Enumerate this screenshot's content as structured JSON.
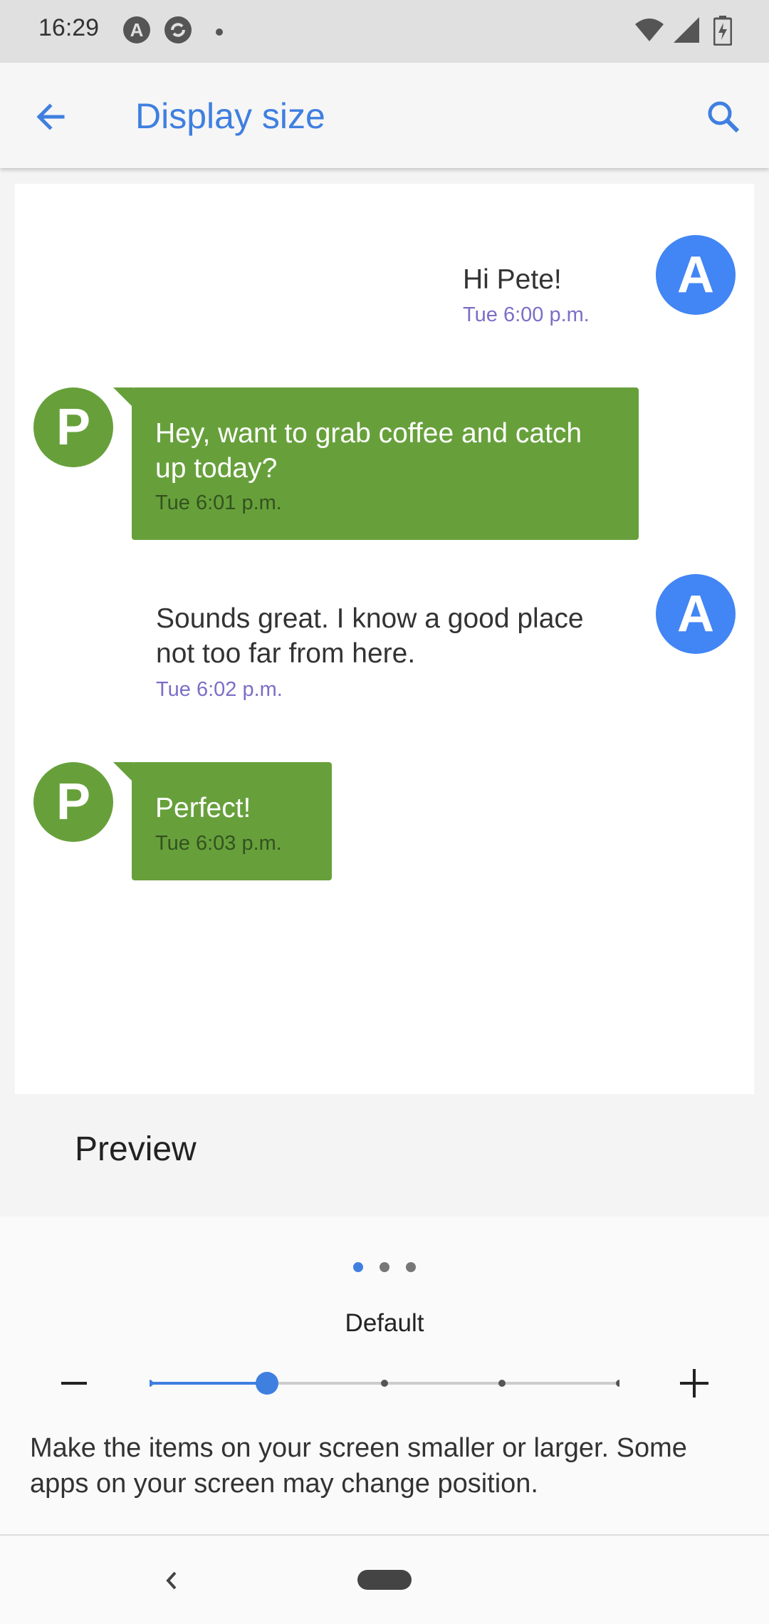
{
  "status_bar": {
    "time": "16:29",
    "left_icons": [
      "a-circle-icon",
      "sync-icon",
      "dot-icon"
    ],
    "right_icons": [
      "wifi-icon",
      "signal-icon",
      "battery-charging-icon"
    ]
  },
  "app_bar": {
    "title": "Display size",
    "back_icon": "arrow-back-icon",
    "search_icon": "search-icon"
  },
  "preview": {
    "messages": [
      {
        "sender": "A",
        "text": "Hi Pete!",
        "time": "Tue 6:00 p.m."
      },
      {
        "sender": "P",
        "text": "Hey, want to grab coffee and catch up today?",
        "time": "Tue 6:01 p.m."
      },
      {
        "sender": "A",
        "text": "Sounds great. I know a good place not too far from here.",
        "time": "Tue 6:02 p.m."
      },
      {
        "sender": "P",
        "text": "Perfect!",
        "time": "Tue 6:03 p.m."
      }
    ],
    "label": "Preview"
  },
  "controls": {
    "page_indicator": {
      "count": 3,
      "active": 1
    },
    "size_label": "Default",
    "decrease_icon": "minus-icon",
    "increase_icon": "plus-icon",
    "slider": {
      "steps": 5,
      "selected_step": 2
    },
    "description": "Make the items on your screen smaller or larger. Some apps on your screen may change position."
  },
  "nav_bar": {
    "back_icon": "chevron-left-icon",
    "home_icon": "home-pill-icon"
  },
  "colors": {
    "accent": "#3f7fe0",
    "avatar_a": "#4285f4",
    "avatar_p": "#67a03b",
    "bubble_p": "#67a03b",
    "timestamp": "#7b6fc6"
  }
}
